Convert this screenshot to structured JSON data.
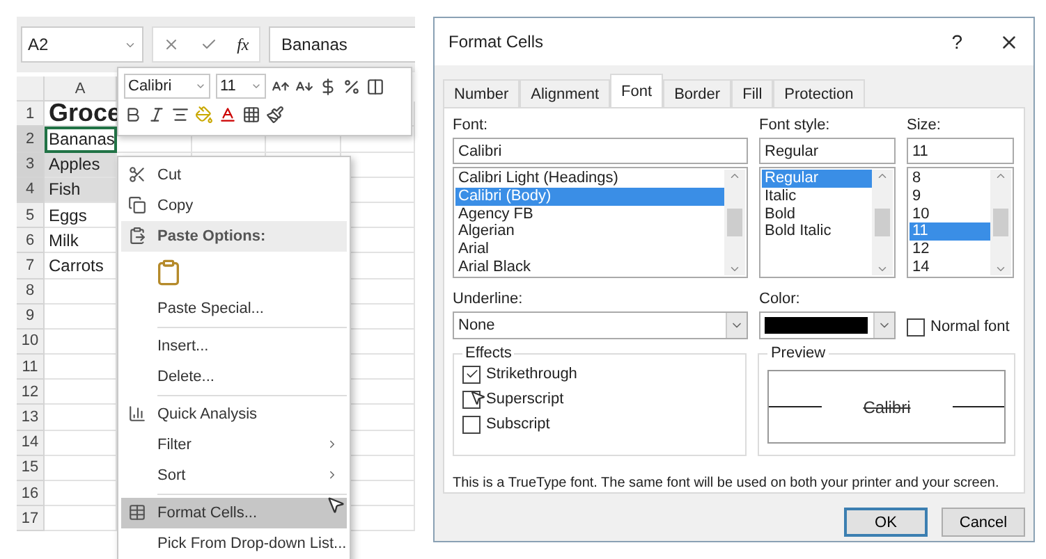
{
  "spreadsheet": {
    "name_box": "A2",
    "function_label": "fx",
    "formula_value": "Bananas",
    "column_header": "A",
    "rows": [
      {
        "number": "1",
        "value": "Groce",
        "kind": "title",
        "selected": false,
        "active": false
      },
      {
        "number": "2",
        "value": "Bananas",
        "kind": "cell",
        "selected": true,
        "active": true
      },
      {
        "number": "3",
        "value": "Apples",
        "kind": "cell",
        "selected": true,
        "active": false
      },
      {
        "number": "4",
        "value": "Fish",
        "kind": "cell",
        "selected": true,
        "active": false
      },
      {
        "number": "5",
        "value": "Eggs",
        "kind": "cell",
        "selected": false,
        "active": false
      },
      {
        "number": "6",
        "value": "Milk",
        "kind": "cell",
        "selected": false,
        "active": false
      },
      {
        "number": "7",
        "value": "Carrots",
        "kind": "cell",
        "selected": false,
        "active": false
      },
      {
        "number": "8",
        "kind": "cell",
        "selected": false,
        "active": false
      },
      {
        "number": "9",
        "kind": "cell",
        "selected": false,
        "active": false
      },
      {
        "number": "10",
        "kind": "cell",
        "selected": false,
        "active": false
      },
      {
        "number": "11",
        "kind": "cell",
        "selected": false,
        "active": false
      },
      {
        "number": "12",
        "kind": "cell",
        "selected": false,
        "active": false
      },
      {
        "number": "13",
        "kind": "cell",
        "selected": false,
        "active": false
      },
      {
        "number": "14",
        "kind": "cell",
        "selected": false,
        "active": false
      },
      {
        "number": "15",
        "kind": "cell",
        "selected": false,
        "active": false
      },
      {
        "number": "16",
        "kind": "cell",
        "selected": false,
        "active": false
      },
      {
        "number": "17",
        "kind": "cell",
        "selected": false,
        "active": false
      }
    ]
  },
  "mini_toolbar": {
    "font": "Calibri",
    "size": "11"
  },
  "context_menu": [
    {
      "kind": "item",
      "label": "Cut",
      "highlighted": false
    },
    {
      "kind": "item",
      "label": "Copy",
      "highlighted": false
    },
    {
      "kind": "header",
      "label": "Paste Options:",
      "highlighted": false
    },
    {
      "kind": "paste-option"
    },
    {
      "kind": "item",
      "label": "Paste Special...",
      "highlighted": false
    },
    {
      "kind": "separator"
    },
    {
      "kind": "item",
      "label": "Insert...",
      "highlighted": false
    },
    {
      "kind": "item",
      "label": "Delete...",
      "highlighted": false
    },
    {
      "kind": "separator"
    },
    {
      "kind": "item",
      "label": "Quick Analysis",
      "highlighted": false
    },
    {
      "kind": "submenu",
      "label": "Filter",
      "highlighted": false
    },
    {
      "kind": "submenu",
      "label": "Sort",
      "highlighted": false
    },
    {
      "kind": "separator"
    },
    {
      "kind": "item",
      "label": "Format Cells...",
      "highlighted": true
    },
    {
      "kind": "item",
      "label": "Pick From Drop-down List...",
      "highlighted": false
    }
  ],
  "dialog": {
    "title": "Format Cells",
    "help": "?",
    "tabs": [
      {
        "label": "Number",
        "selected": false
      },
      {
        "label": "Alignment",
        "selected": false
      },
      {
        "label": "Font",
        "selected": true
      },
      {
        "label": "Border",
        "selected": false
      },
      {
        "label": "Fill",
        "selected": false
      },
      {
        "label": "Protection",
        "selected": false
      }
    ],
    "font": {
      "label": "Font:",
      "value": "Calibri",
      "options": [
        {
          "label": "Calibri Light (Headings)",
          "selected": false
        },
        {
          "label": "Calibri (Body)",
          "selected": true
        },
        {
          "label": "Agency FB",
          "selected": false
        },
        {
          "label": "Algerian",
          "selected": false
        },
        {
          "label": "Arial",
          "selected": false
        },
        {
          "label": "Arial Black",
          "selected": false
        }
      ]
    },
    "font_style": {
      "label": "Font style:",
      "value": "Regular",
      "options": [
        {
          "label": "Regular",
          "selected": true
        },
        {
          "label": "Italic",
          "selected": false
        },
        {
          "label": "Bold",
          "selected": false
        },
        {
          "label": "Bold Italic",
          "selected": false
        }
      ]
    },
    "size": {
      "label": "Size:",
      "value": "11",
      "options": [
        {
          "label": "8",
          "selected": false
        },
        {
          "label": "9",
          "selected": false
        },
        {
          "label": "10",
          "selected": false
        },
        {
          "label": "11",
          "selected": true
        },
        {
          "label": "12",
          "selected": false
        },
        {
          "label": "14",
          "selected": false
        }
      ]
    },
    "underline": {
      "label": "Underline:",
      "value": "None"
    },
    "color": {
      "label": "Color:",
      "color": "#000000"
    },
    "normal_font": {
      "label": "Normal font",
      "checked": false
    },
    "effects": {
      "title": "Effects",
      "options": [
        {
          "label": "Strikethrough",
          "checked": true
        },
        {
          "label": "Superscript",
          "checked": false
        },
        {
          "label": "Subscript",
          "checked": false
        }
      ]
    },
    "preview": {
      "title": "Preview",
      "text": "Calibri"
    },
    "info": "This is a TrueType font.  The same font will be used on both your printer and your screen.",
    "buttons": [
      {
        "label": "OK",
        "default": true
      },
      {
        "label": "Cancel",
        "default": false
      }
    ]
  }
}
